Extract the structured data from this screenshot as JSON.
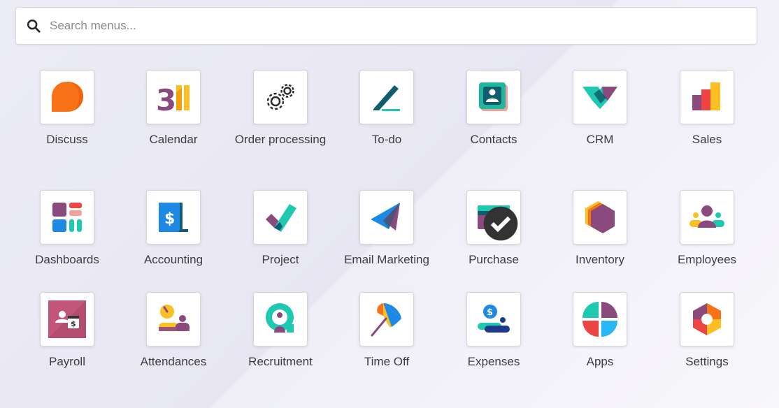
{
  "search": {
    "placeholder": "Search menus..."
  },
  "apps": [
    {
      "label": "Discuss",
      "icon": "discuss-icon"
    },
    {
      "label": "Calendar",
      "icon": "calendar-icon"
    },
    {
      "label": "Order processing",
      "icon": "gears-icon"
    },
    {
      "label": "To-do",
      "icon": "pen-line-icon"
    },
    {
      "label": "Contacts",
      "icon": "contact-card-icon"
    },
    {
      "label": "CRM",
      "icon": "handshake-icon"
    },
    {
      "label": "Sales",
      "icon": "bars-icon"
    },
    {
      "label": "Dashboards",
      "icon": "dashboard-icon"
    },
    {
      "label": "Accounting",
      "icon": "invoice-dollar-icon"
    },
    {
      "label": "Project",
      "icon": "checkmark-icon"
    },
    {
      "label": "Email Marketing",
      "icon": "paper-plane-icon"
    },
    {
      "label": "Purchase",
      "icon": "credit-card-icon"
    },
    {
      "label": "Inventory",
      "icon": "box-hexagon-icon"
    },
    {
      "label": "Employees",
      "icon": "people-icon"
    },
    {
      "label": "Payroll",
      "icon": "payroll-icon"
    },
    {
      "label": "Attendances",
      "icon": "clock-person-icon"
    },
    {
      "label": "Recruitment",
      "icon": "magnifier-person-icon"
    },
    {
      "label": "Time Off",
      "icon": "umbrella-icon"
    },
    {
      "label": "Expenses",
      "icon": "money-person-icon"
    },
    {
      "label": "Apps",
      "icon": "apps-circle-icon"
    },
    {
      "label": "Settings",
      "icon": "hexagon-gear-icon"
    }
  ],
  "colors": {
    "orange": "#f97316",
    "purple": "#8b4a7e",
    "teal": "#1fc8b0",
    "blue": "#1e88e5",
    "dark_teal": "#0f5d6e",
    "yellow": "#fbbf24",
    "red": "#ef4444"
  }
}
